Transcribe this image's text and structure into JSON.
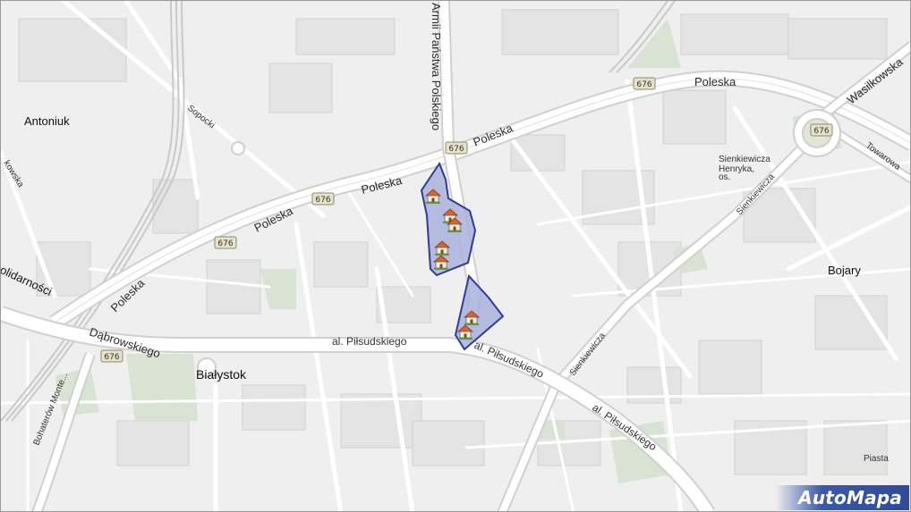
{
  "colors": {
    "background": "#efefef",
    "block": "#e3e3e3",
    "road": "#ffffff",
    "road_casing": "#d6d6d6",
    "rail": "#c9c9c9",
    "green": "#d8e3d2",
    "highlight_fill": "#aab0dc",
    "highlight_stroke": "#2f3c96",
    "shield_fill": "#e6e1c8",
    "logo": "#3c58a8"
  },
  "map": {
    "districts": {
      "antoniuk": "Antoniuk",
      "bojary": "Bojary",
      "bialystok": "Białystok",
      "solidarnosci": "olidarności"
    },
    "streets": {
      "poleska_1": "Poleska",
      "poleska_2": "Poleska",
      "poleska_3": "Poleska",
      "poleska_4": "Poleska",
      "poleska_5": "Poleska",
      "sopocki": "Sopocki",
      "kowska": "kowska",
      "armii": "Armii Państwa Polskiego",
      "wasilkowska": "Wasilkowska",
      "towarowa": "Towarowa",
      "sienkiewicza_1": "Sienkiewicza",
      "sienkiewicza_2": "Sienkiewicza",
      "dabrowskiego": "Dąbrowskiego",
      "pilsudskiego_1": "al. Piłsudskiego",
      "pilsudskiego_2": "al. Piłsudskiego",
      "pilsudskiego_3": "al. Piłsudskiego",
      "bohaterow": "Bohaterów Monte..."
    },
    "poi": {
      "sienkiewicza_os_1": "Sienkiewicza",
      "sienkiewicza_os_2": "Henryka,",
      "sienkiewicza_os_3": "os.",
      "piasta": "Piasta"
    },
    "route_shields": [
      "676",
      "676",
      "676",
      "676",
      "676",
      "676"
    ],
    "property_markers": 7
  },
  "logo": {
    "text": "AutoMapa"
  }
}
